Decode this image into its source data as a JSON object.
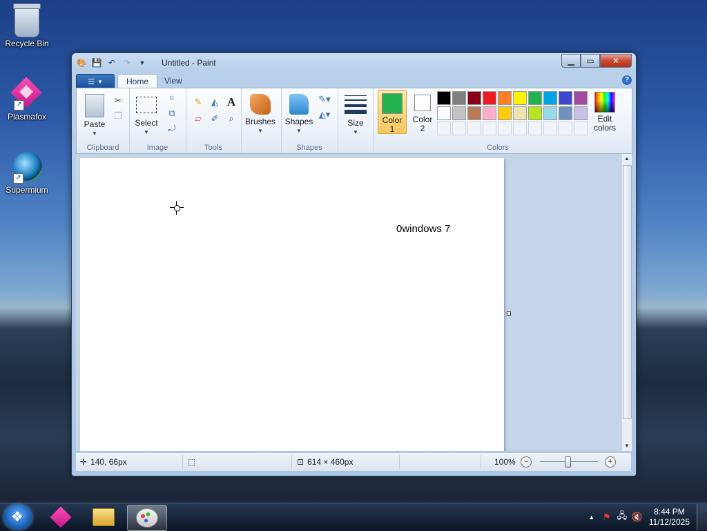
{
  "desktop": {
    "icons": [
      {
        "label": "Recycle Bin"
      },
      {
        "label": "Plasmafox"
      },
      {
        "label": "Supermium"
      }
    ]
  },
  "window": {
    "title": "Untitled - Paint",
    "tabs": [
      {
        "label": "Home"
      },
      {
        "label": "View"
      }
    ],
    "help": "?"
  },
  "ribbon": {
    "clipboard": {
      "label": "Clipboard",
      "paste": "Paste"
    },
    "image": {
      "label": "Image",
      "select": "Select"
    },
    "tools": {
      "label": "Tools",
      "text_tool": "A"
    },
    "brushes": {
      "label": "Brushes"
    },
    "shapes": {
      "label": "Shapes",
      "shapes_btn": "Shapes"
    },
    "size": {
      "label": "Size"
    },
    "colors": {
      "label": "Colors",
      "color1": {
        "label": "Color 1",
        "line1": "Color",
        "line2": "1",
        "value": "#22b14c"
      },
      "color2": {
        "label": "Color 2",
        "line1": "Color",
        "line2": "2",
        "value": "#ffffff"
      },
      "edit_colors_line1": "Edit",
      "edit_colors_line2": "colors",
      "palette": [
        "#000000",
        "#7f7f7f",
        "#880015",
        "#ed1c24",
        "#ff7f27",
        "#fff200",
        "#22b14c",
        "#00a2e8",
        "#3f48cc",
        "#a349a4",
        "#ffffff",
        "#c3c3c3",
        "#b97a57",
        "#ffaec9",
        "#ffc90e",
        "#efe4b0",
        "#b5e61d",
        "#99d9ea",
        "#7092be",
        "#c8bfe7"
      ]
    }
  },
  "canvas": {
    "text": "0windows 7"
  },
  "status": {
    "cursor_pos": "140, 66px",
    "canvas_size": "614 × 460px",
    "zoom": "100%"
  },
  "taskbar": {
    "time": "8:44 PM",
    "date": "11/12/2025"
  }
}
